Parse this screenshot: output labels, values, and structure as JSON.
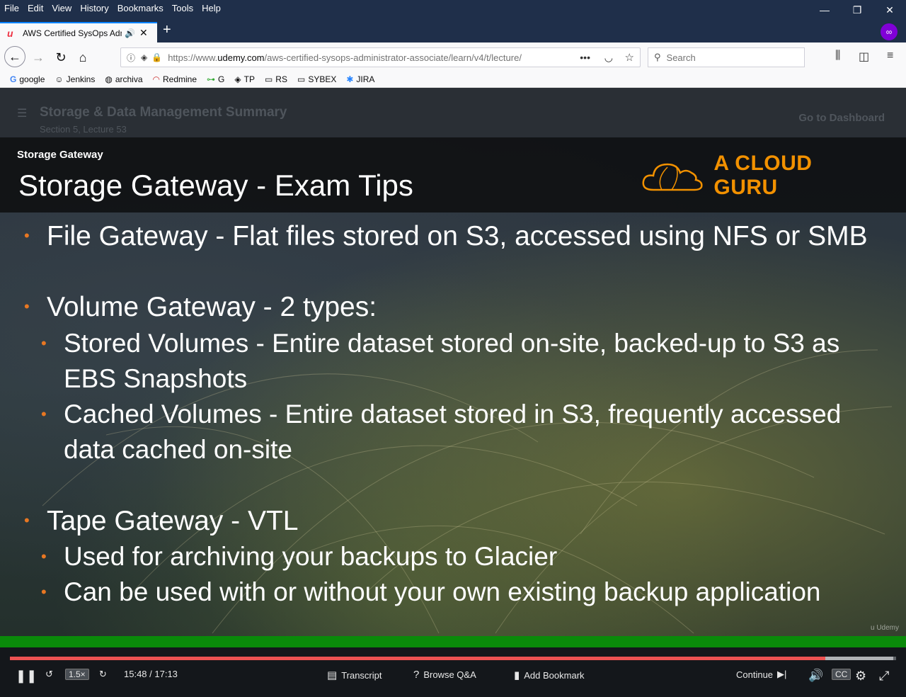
{
  "menu": [
    "File",
    "Edit",
    "View",
    "History",
    "Bookmarks",
    "Tools",
    "Help"
  ],
  "window": {
    "minimize": "—",
    "restore": "❐",
    "close": "✕"
  },
  "tab": {
    "title": "AWS Certified SysOps Admi",
    "newtab": "+"
  },
  "nav": {
    "url_prefix": "https://www.",
    "url_domain": "udemy.com",
    "url_path": "/aws-certified-sysops-administrator-associate/learn/v4/t/lecture/",
    "search_placeholder": "Search"
  },
  "bookmarks": [
    {
      "label": "google",
      "icon": "G"
    },
    {
      "label": "Jenkins",
      "icon": "☺"
    },
    {
      "label": "archiva",
      "icon": "◍"
    },
    {
      "label": "Redmine",
      "icon": "◠"
    },
    {
      "label": "G",
      "icon": "⊶"
    },
    {
      "label": "TP",
      "icon": "◈"
    },
    {
      "label": "RS",
      "icon": "▭"
    },
    {
      "label": "SYBEX",
      "icon": "▭"
    },
    {
      "label": "JIRA",
      "icon": "✱"
    }
  ],
  "lecture": {
    "title": "Storage & Data Management Summary",
    "subtitle": "Section 5, Lecture 53",
    "dashboard": "Go to Dashboard"
  },
  "slide": {
    "kicker": "Storage Gateway",
    "title": "Storage Gateway - Exam Tips",
    "brand": "A CLOUD GURU",
    "brand_color": "#f29100",
    "bullet_color": "#e87722",
    "lines": [
      "File Gateway  - Flat files stored on S3, accessed using NFS or SMB",
      "Volume Gateway - 2 types:",
      "Stored Volumes - Entire dataset stored on-site, backed-up to S3 as",
      "EBS Snapshots",
      "Cached Volumes - Entire dataset stored in S3, frequently accessed",
      "data cached on-site",
      "Tape Gateway - VTL",
      "Used for archiving your backups to Glacier",
      "Can be used with or without your own existing backup application"
    ],
    "watermark": "Udemy"
  },
  "player": {
    "speed": "1.5×",
    "time": "15:48 / 17:13",
    "progress": 0.92,
    "buffered": 0.997,
    "transcript": "Transcript",
    "qa": "Browse Q&A",
    "bookmark": "Add Bookmark",
    "continue": "Continue",
    "cc": "CC"
  }
}
